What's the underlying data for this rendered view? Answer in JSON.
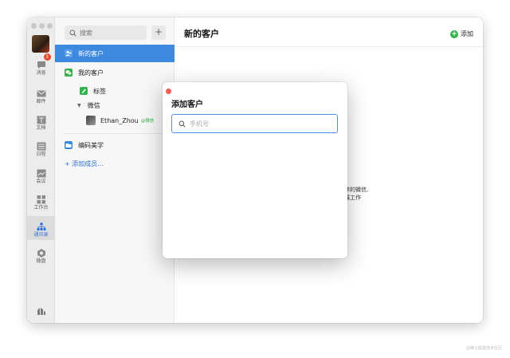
{
  "rail": {
    "items": [
      {
        "label": "消息",
        "badge": "3"
      },
      {
        "label": "邮件"
      },
      {
        "label": "文档"
      },
      {
        "label": "日程"
      },
      {
        "label": "会议"
      },
      {
        "label": "工作台"
      },
      {
        "label": "通讯录",
        "active": true
      },
      {
        "label": "微盘"
      }
    ]
  },
  "contacts": {
    "search_placeholder": "搜索",
    "add_symbol": "+",
    "new_customers": "新的客户",
    "my_customers": "我的客户",
    "tags": "标签",
    "wechat": "微信",
    "wechat_contact_name": "Ethan_Zhou",
    "wechat_contact_badge": "@微信",
    "org_name": "编码美学",
    "add_member": "+ 添加成员..."
  },
  "main": {
    "title": "新的客户",
    "add_label": "添加",
    "bg_line1": "伴的微信,",
    "bg_line2": "展工作"
  },
  "modal": {
    "title": "添加客户",
    "input_placeholder": "手机号",
    "input_value": ""
  },
  "watermark": "@稀土掘金技术社区",
  "colors": {
    "accent": "#3d89e0",
    "green": "#32b24a",
    "badge_red": "#e8452f",
    "close_red": "#ee5f55"
  }
}
